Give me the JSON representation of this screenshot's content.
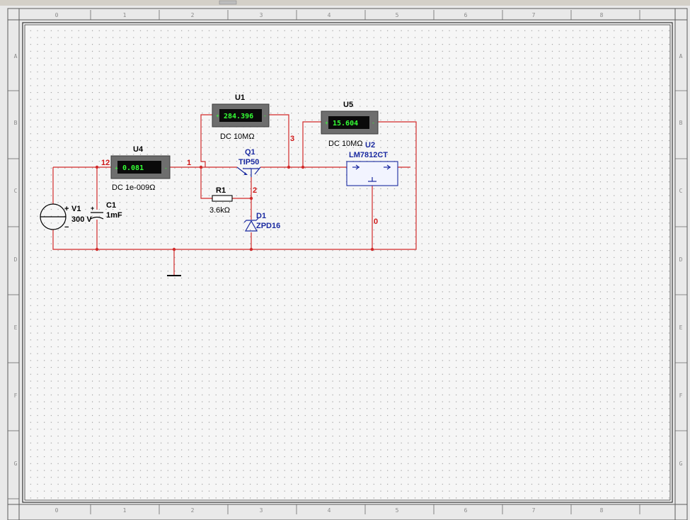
{
  "rulers": {
    "columns": [
      "0",
      "1",
      "2",
      "3",
      "4",
      "5",
      "6",
      "7",
      "8"
    ],
    "rows": [
      "A",
      "B",
      "C",
      "D",
      "E",
      "F",
      "G"
    ]
  },
  "components": {
    "v1": {
      "ref": "V1",
      "value": "300 V",
      "plus": "+",
      "minus": "−"
    },
    "c1": {
      "ref": "C1",
      "value": "1mF",
      "plus": "+"
    },
    "u4": {
      "ref": "U4",
      "reading": "0.081",
      "mode": "DC  1e-009Ω"
    },
    "u1": {
      "ref": "U1",
      "reading": "284.396",
      "mode": "DC  10MΩ"
    },
    "u5": {
      "ref": "U5",
      "reading": "15.604",
      "mode": "DC  10MΩ"
    },
    "q1": {
      "ref": "Q1",
      "part": "TIP50"
    },
    "r1": {
      "ref": "R1",
      "value": "3.6kΩ"
    },
    "d1": {
      "ref": "D1",
      "part": "ZPD16"
    },
    "u2": {
      "ref": "U2",
      "part": "LM7812CT"
    }
  },
  "nets": {
    "n12": "12",
    "n1": "1",
    "n3": "3",
    "n2": "2",
    "n0": "0"
  },
  "colors": {
    "wire": "#d22a2a",
    "component": "#1a2aa0",
    "meter_display": "#0a0a0a",
    "meter_text": "#35ff35",
    "meter_body": "#6e6e6e"
  }
}
